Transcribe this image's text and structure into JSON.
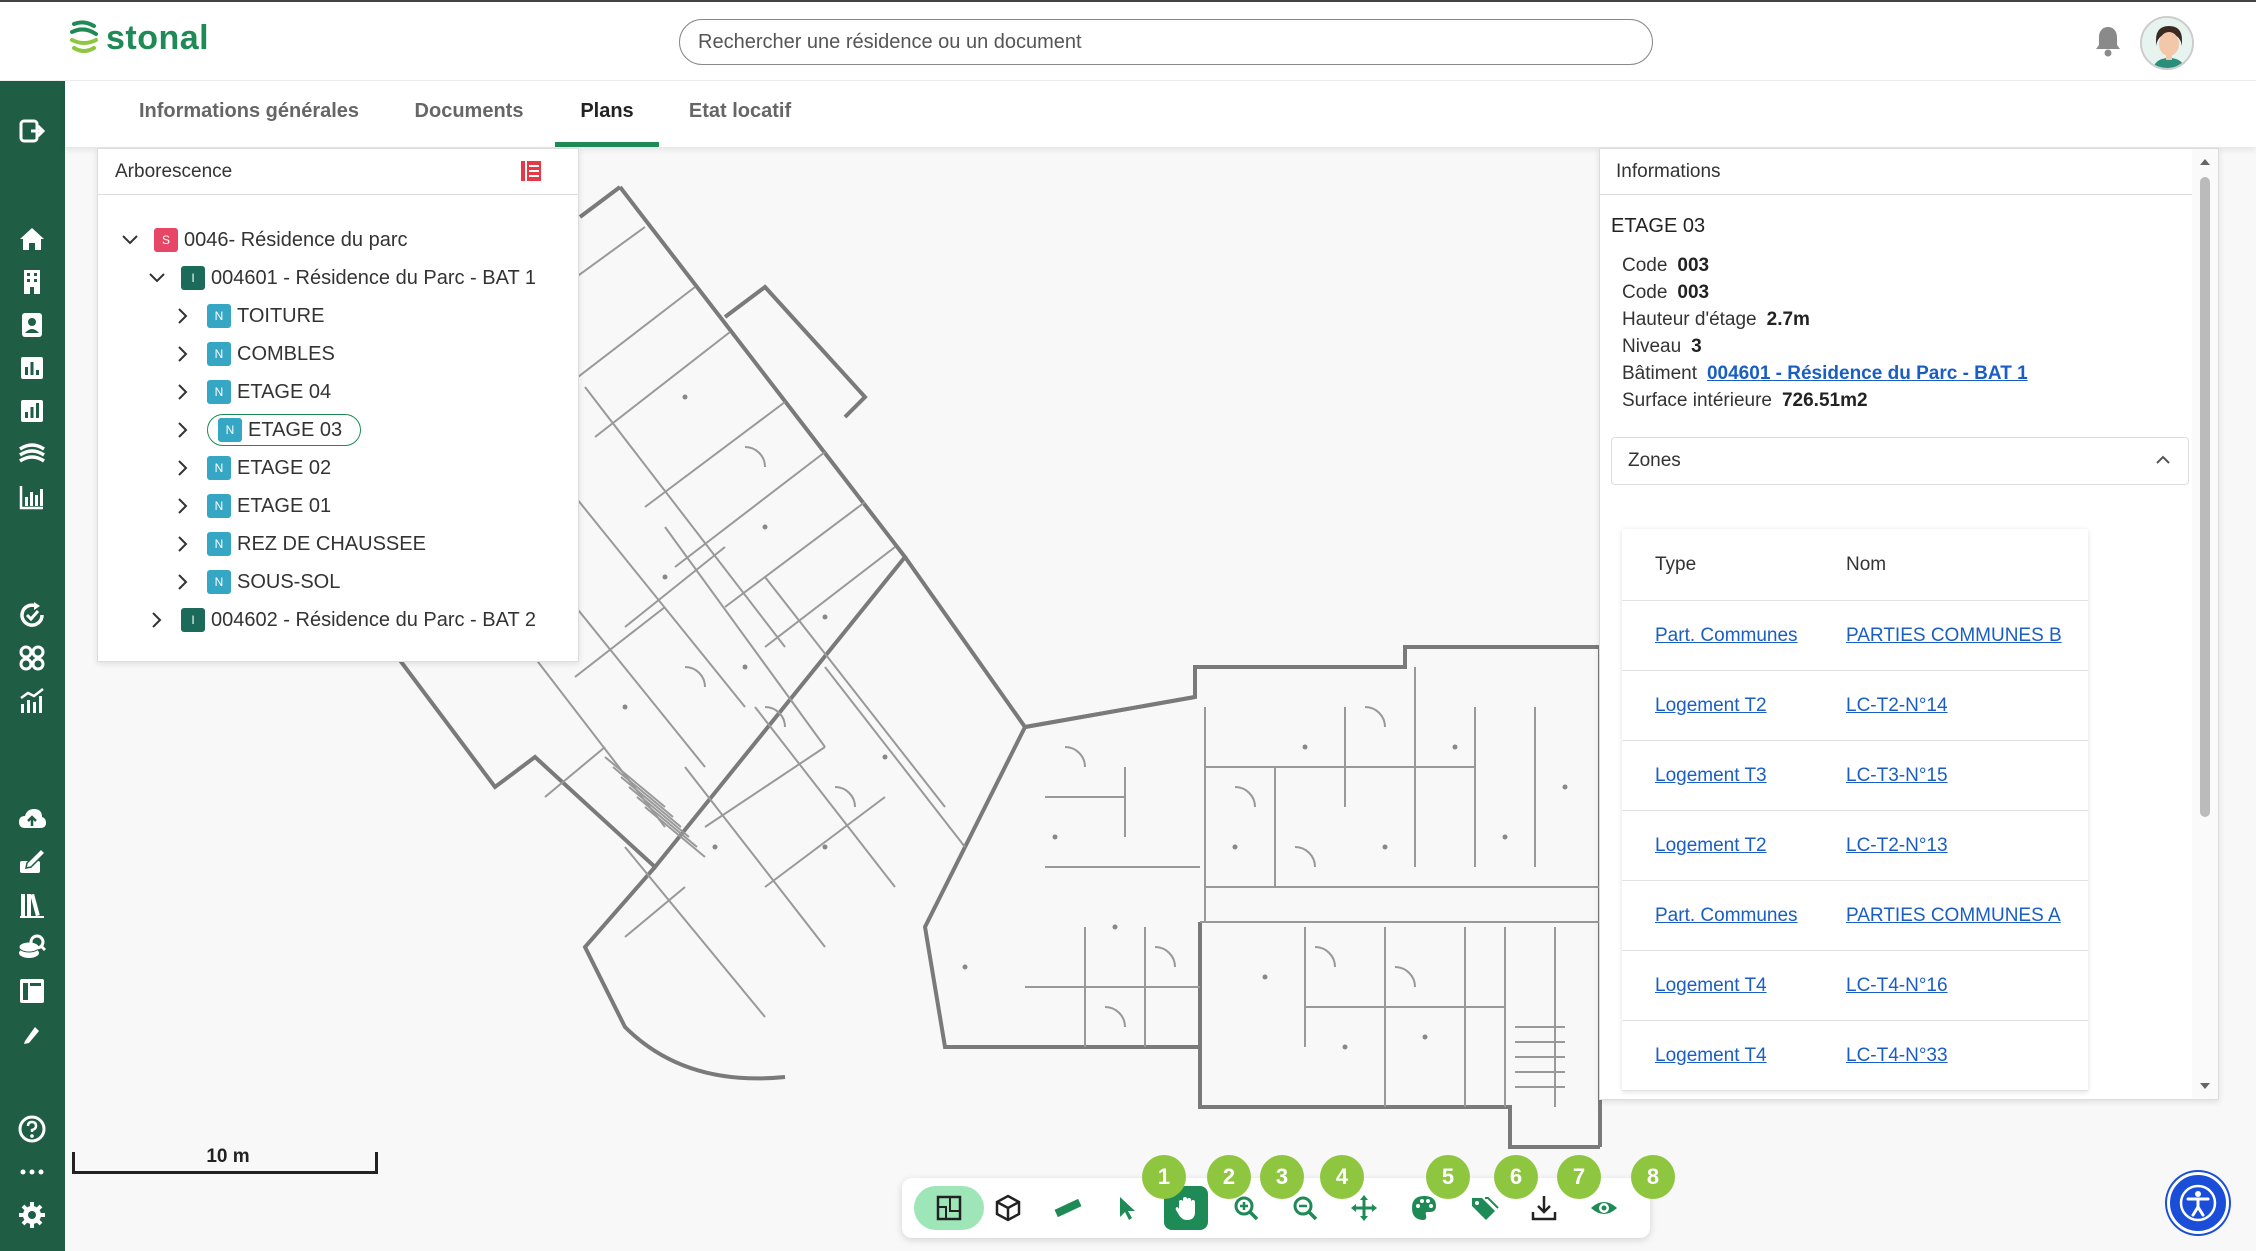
{
  "app": {
    "brand": "stonal",
    "brand_color": "#1e8a55",
    "sidebar_color": "#1f5d44"
  },
  "search": {
    "placeholder": "Rechercher une résidence ou un document",
    "value": ""
  },
  "sidebar": {
    "items": [
      {
        "icon": "logout-icon"
      },
      {
        "icon": "home-icon"
      },
      {
        "icon": "building-icon"
      },
      {
        "icon": "contact-card-icon"
      },
      {
        "icon": "bar-chart-icon"
      },
      {
        "icon": "bar-chart-alt-icon"
      },
      {
        "icon": "stonal-logo-icon"
      },
      {
        "icon": "analytics-icon"
      },
      {
        "icon": "sync-icon"
      },
      {
        "icon": "apps-icon"
      },
      {
        "icon": "trend-chart-icon"
      },
      {
        "icon": "cloud-upload-icon"
      },
      {
        "icon": "edit-stack-icon"
      },
      {
        "icon": "library-icon"
      },
      {
        "icon": "search-database-icon"
      },
      {
        "icon": "layout-icon"
      },
      {
        "icon": "pen-icon"
      },
      {
        "icon": "help-icon"
      },
      {
        "icon": "more-icon"
      },
      {
        "icon": "settings-icon"
      }
    ]
  },
  "tabs": [
    {
      "label": "Informations générales",
      "active": false
    },
    {
      "label": "Documents",
      "active": false
    },
    {
      "label": "Plans",
      "active": true
    },
    {
      "label": "Etat locatif",
      "active": false
    }
  ],
  "tree": {
    "title": "Arborescence",
    "nodes": [
      {
        "badge": "S",
        "label": "0046- Résidence du parc",
        "expanded": true
      },
      {
        "badge": "I",
        "label": "004601 - Résidence du Parc - BAT 1",
        "expanded": true
      },
      {
        "badge": "N",
        "label": "TOITURE"
      },
      {
        "badge": "N",
        "label": "COMBLES"
      },
      {
        "badge": "N",
        "label": "ETAGE 04"
      },
      {
        "badge": "N",
        "label": "ETAGE 03",
        "selected": true
      },
      {
        "badge": "N",
        "label": "ETAGE 02"
      },
      {
        "badge": "N",
        "label": "ETAGE 01"
      },
      {
        "badge": "N",
        "label": "REZ DE CHAUSSEE"
      },
      {
        "badge": "N",
        "label": "SOUS-SOL"
      },
      {
        "badge": "I",
        "label": "004602 - Résidence du Parc - BAT 2",
        "expanded": false
      }
    ]
  },
  "info": {
    "title": "Informations",
    "heading": "ETAGE 03",
    "props": [
      {
        "label": "Code",
        "value": "003"
      },
      {
        "label": "Code",
        "value": "003"
      },
      {
        "label": "Hauteur d'étage",
        "value": "2.7m"
      },
      {
        "label": "Niveau",
        "value": "3"
      },
      {
        "label": "Bâtiment",
        "value": "004601 - Résidence du Parc - BAT 1",
        "link": true
      },
      {
        "label": "Surface intérieure",
        "value": "726.51m2"
      }
    ],
    "zones_label": "Zones",
    "zones_headers": [
      "Type",
      "Nom"
    ],
    "zones": [
      {
        "type": "Part. Communes",
        "name": "PARTIES COMMUNES B"
      },
      {
        "type": "Logement T2",
        "name": "LC-T2-N°14"
      },
      {
        "type": "Logement T3",
        "name": "LC-T3-N°15"
      },
      {
        "type": "Logement T2",
        "name": "LC-T2-N°13"
      },
      {
        "type": "Part. Communes",
        "name": "PARTIES COMMUNES A"
      },
      {
        "type": "Logement T4",
        "name": "LC-T4-N°16"
      },
      {
        "type": "Logement T4",
        "name": "LC-T4-N°33"
      }
    ]
  },
  "scale": {
    "label": "10 m"
  },
  "toolbar": {
    "tools": [
      {
        "icon": "2d-plan-icon",
        "active": true
      },
      {
        "icon": "3d-cube-icon"
      },
      {
        "icon": "ruler-icon"
      },
      {
        "icon": "pointer-icon"
      },
      {
        "icon": "hand-icon",
        "active": true
      },
      {
        "icon": "zoom-in-icon"
      },
      {
        "icon": "zoom-out-icon"
      },
      {
        "icon": "move-icon"
      },
      {
        "icon": "palette-icon"
      },
      {
        "icon": "tags-icon"
      },
      {
        "icon": "download-icon"
      },
      {
        "icon": "eye-icon"
      }
    ],
    "markers": [
      "1",
      "2",
      "3",
      "4",
      "5",
      "6",
      "7",
      "8"
    ]
  }
}
